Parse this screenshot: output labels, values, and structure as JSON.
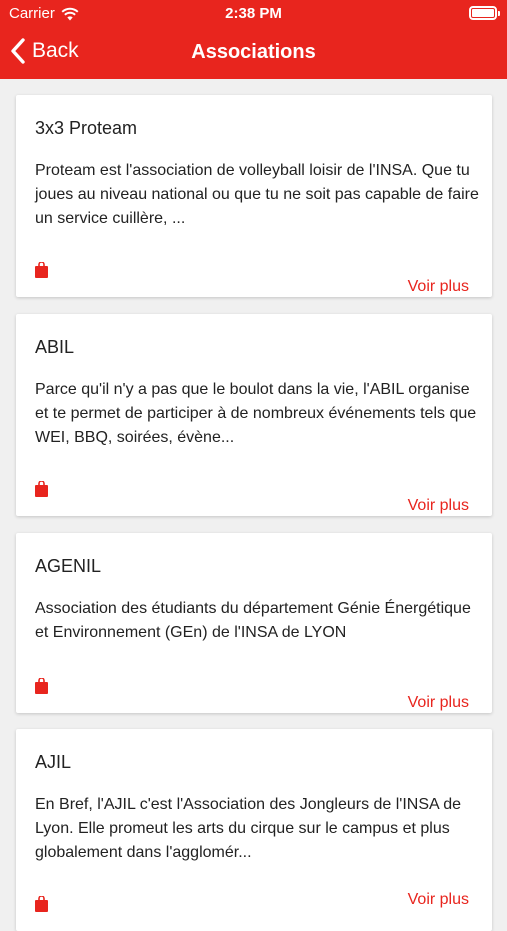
{
  "status": {
    "carrier": "Carrier",
    "time": "2:38 PM"
  },
  "nav": {
    "back_label": "Back",
    "title": "Associations"
  },
  "colors": {
    "accent": "#e8251e",
    "background": "#f0f0f0"
  },
  "cards": [
    {
      "title": "3x3 Proteam",
      "description": "Proteam est l'association de volleyball loisir de l'INSA. Que tu joues au niveau national ou que tu ne soit pas capable de faire un service cuillère, ...",
      "icon": "bag-icon",
      "more_label": "Voir plus"
    },
    {
      "title": "ABIL",
      "description": "Parce qu'il n'y a pas que le boulot dans la vie, l'ABIL organise et te permet de participer à de nombreux événements tels que WEI, BBQ, soirées, évène...",
      "icon": "bag-icon",
      "more_label": "Voir plus"
    },
    {
      "title": "AGENIL",
      "description": "Association des étudiants du département Génie Énergétique et Environnement (GEn) de l'INSA de LYON",
      "icon": "bag-icon",
      "more_label": "Voir plus"
    },
    {
      "title": "AJIL",
      "description": "En Bref, l'AJIL c'est l'Association des Jongleurs de l'INSA de Lyon. Elle promeut les arts du cirque sur le campus et plus globalement dans l'agglomér...",
      "icon": "bag-icon",
      "more_label": "Voir plus"
    }
  ]
}
